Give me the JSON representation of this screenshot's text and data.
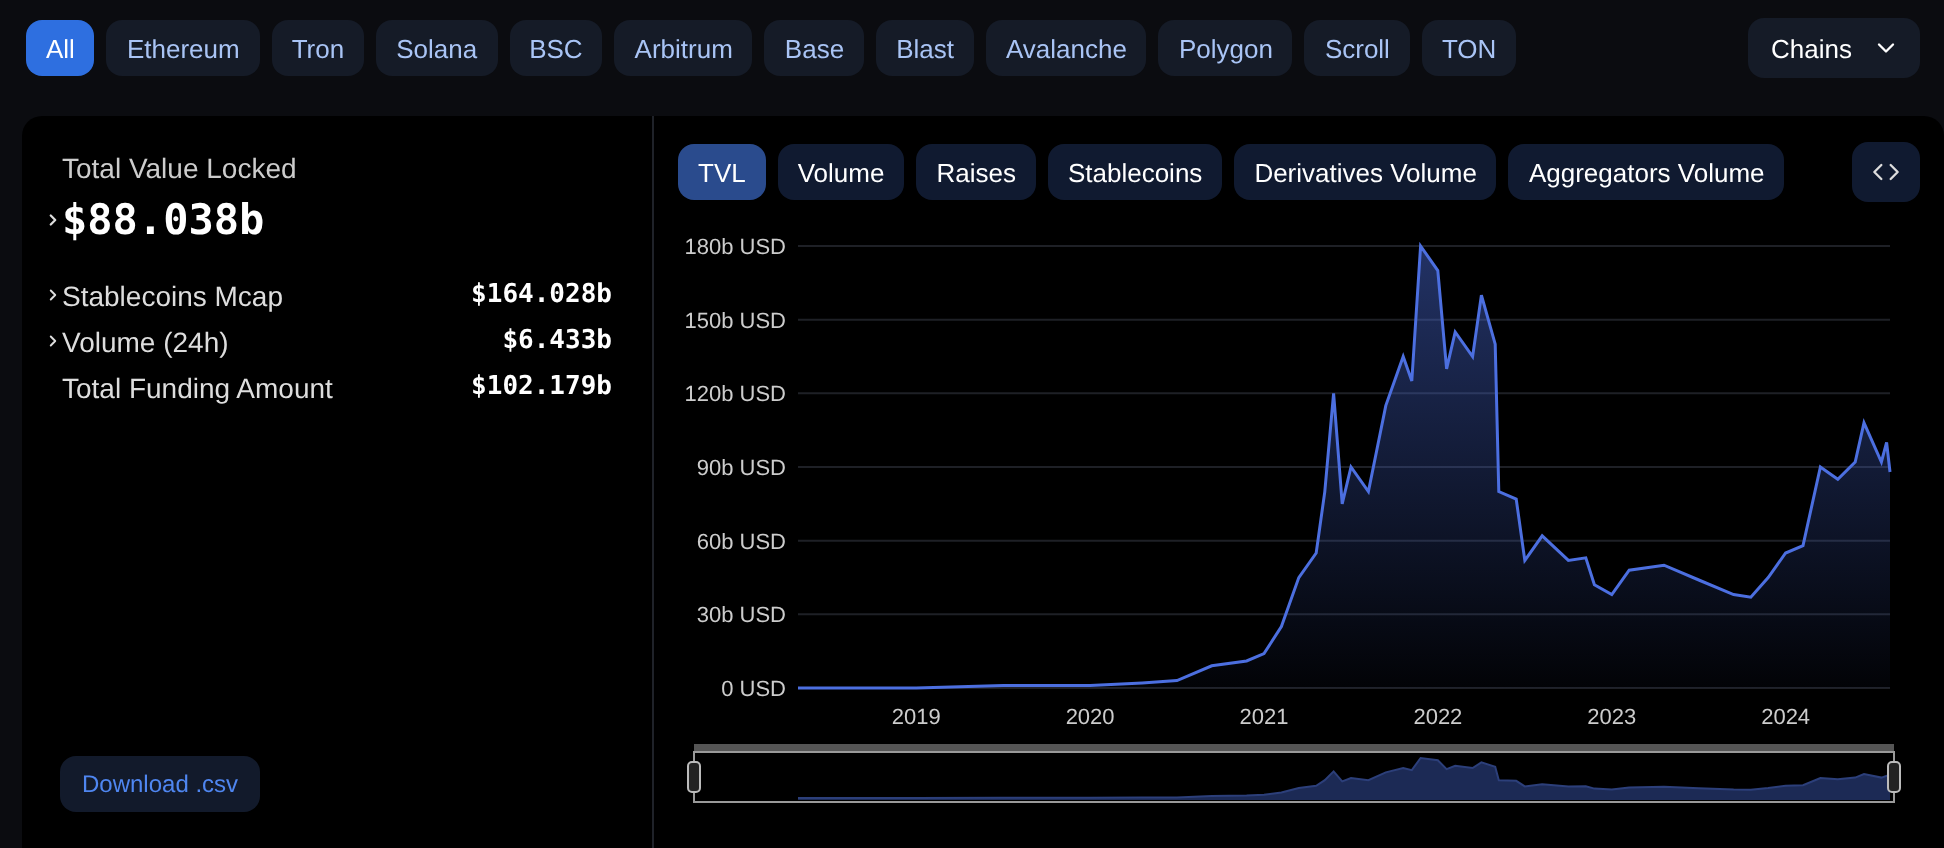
{
  "chain_tabs": [
    {
      "label": "All",
      "selected": true
    },
    {
      "label": "Ethereum",
      "selected": false
    },
    {
      "label": "Tron",
      "selected": false
    },
    {
      "label": "Solana",
      "selected": false
    },
    {
      "label": "BSC",
      "selected": false
    },
    {
      "label": "Arbitrum",
      "selected": false
    },
    {
      "label": "Base",
      "selected": false
    },
    {
      "label": "Blast",
      "selected": false
    },
    {
      "label": "Avalanche",
      "selected": false
    },
    {
      "label": "Polygon",
      "selected": false
    },
    {
      "label": "Scroll",
      "selected": false
    },
    {
      "label": "TON",
      "selected": false
    }
  ],
  "chains_dropdown": {
    "label": "Chains"
  },
  "summary": {
    "title": "Total Value Locked",
    "value": "$88.038b",
    "expandable": true,
    "stats": [
      {
        "label": "Stablecoins Mcap",
        "value": "$164.028b",
        "expandable": true
      },
      {
        "label": "Volume (24h)",
        "value": "$6.433b",
        "expandable": true
      },
      {
        "label": "Total Funding Amount",
        "value": "$102.179b",
        "expandable": false
      }
    ],
    "download_button": "Download .csv"
  },
  "chart_tabs": [
    {
      "label": "TVL",
      "selected": true
    },
    {
      "label": "Volume",
      "selected": false
    },
    {
      "label": "Raises",
      "selected": false
    },
    {
      "label": "Stablecoins",
      "selected": false
    },
    {
      "label": "Derivatives Volume",
      "selected": false
    },
    {
      "label": "Aggregators Volume",
      "selected": false
    }
  ],
  "chart_data": {
    "type": "area",
    "grid": true,
    "ylim": [
      0,
      180
    ],
    "xlim": [
      2018.32,
      2024.6
    ],
    "yticks": [
      {
        "value": 0,
        "label": "0 USD"
      },
      {
        "value": 30,
        "label": "30b USD"
      },
      {
        "value": 60,
        "label": "60b USD"
      },
      {
        "value": 90,
        "label": "90b USD"
      },
      {
        "value": 120,
        "label": "120b USD"
      },
      {
        "value": 150,
        "label": "150b USD"
      },
      {
        "value": 180,
        "label": "180b USD"
      }
    ],
    "xticks": [
      {
        "value": 2019,
        "label": "2019"
      },
      {
        "value": 2020,
        "label": "2020"
      },
      {
        "value": 2021,
        "label": "2021"
      },
      {
        "value": 2022,
        "label": "2022"
      },
      {
        "value": 2023,
        "label": "2023"
      },
      {
        "value": 2024,
        "label": "2024"
      }
    ],
    "x": [
      2018.32,
      2019,
      2019.5,
      2020,
      2020.3,
      2020.5,
      2020.7,
      2020.9,
      2021,
      2021.1,
      2021.2,
      2021.3,
      2021.35,
      2021.4,
      2021.45,
      2021.5,
      2021.6,
      2021.7,
      2021.8,
      2021.85,
      2021.9,
      2022,
      2022.05,
      2022.1,
      2022.2,
      2022.25,
      2022.33,
      2022.35,
      2022.45,
      2022.5,
      2022.6,
      2022.75,
      2022.85,
      2022.9,
      2023,
      2023.1,
      2023.3,
      2023.5,
      2023.7,
      2023.8,
      2023.9,
      2024,
      2024.1,
      2024.2,
      2024.3,
      2024.4,
      2024.45,
      2024.55,
      2024.58,
      2024.6
    ],
    "series": [
      {
        "color": "#4c6fe0",
        "values": [
          0,
          0,
          1,
          1,
          2,
          3,
          9,
          11,
          14,
          25,
          45,
          55,
          80,
          120,
          75,
          90,
          80,
          115,
          135,
          125,
          180,
          170,
          130,
          145,
          135,
          160,
          140,
          80,
          77,
          52,
          62,
          52,
          53,
          42,
          38,
          48,
          50,
          44,
          38,
          37,
          45,
          55,
          58,
          90,
          85,
          92,
          108,
          92,
          100,
          88
        ]
      }
    ]
  }
}
